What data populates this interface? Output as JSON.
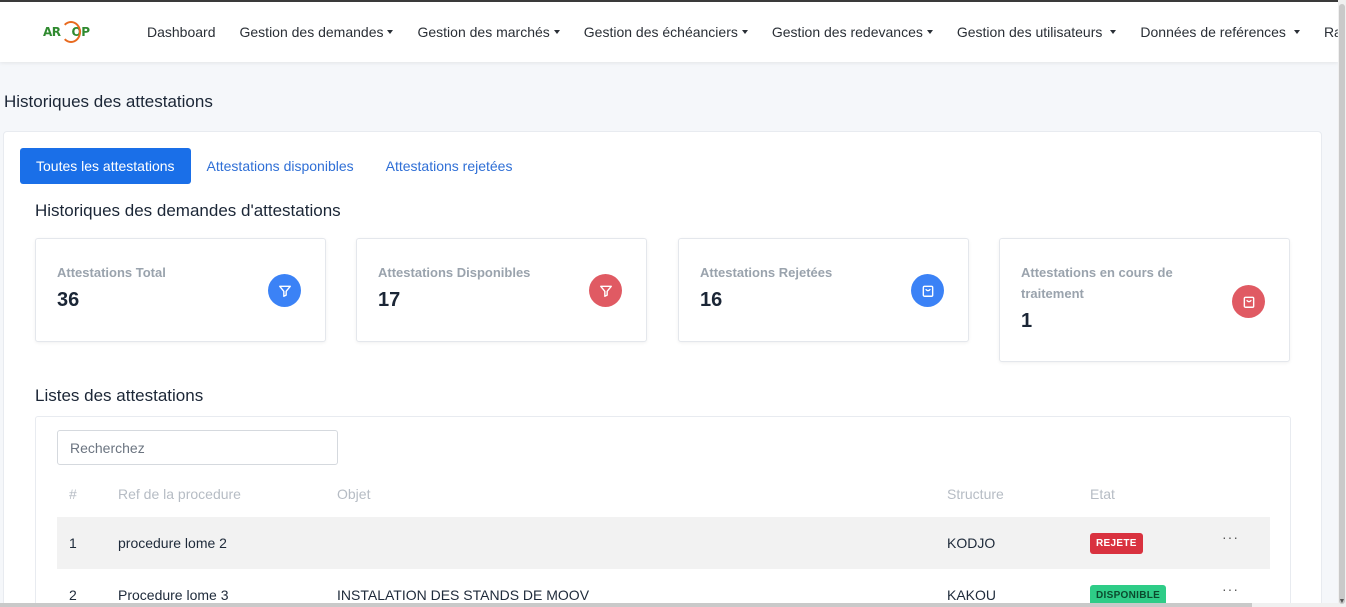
{
  "header": {
    "logo_text": "ARCOP",
    "nav": [
      {
        "label": "Dashboard",
        "dropdown": false
      },
      {
        "label": "Gestion des demandes",
        "dropdown": true
      },
      {
        "label": "Gestion des marchés",
        "dropdown": true
      },
      {
        "label": "Gestion des échéanciers",
        "dropdown": true
      },
      {
        "label": "Gestion des redevances",
        "dropdown": true
      },
      {
        "label": "Gestion des utilisateurs",
        "dropdown": true
      },
      {
        "label": "Données de reférences",
        "dropdown": true
      },
      {
        "label": "Rapports",
        "dropdown": false
      }
    ]
  },
  "page": {
    "title": "Historiques des attestations"
  },
  "tabs": [
    {
      "label": "Toutes les attestations",
      "active": true
    },
    {
      "label": "Attestations disponibles",
      "active": false
    },
    {
      "label": "Attestations rejetées",
      "active": false
    }
  ],
  "section_title": "Historiques des demandes d'attestations",
  "cards": [
    {
      "label": "Attestations Total",
      "value": "36",
      "icon": "filter-icon",
      "color": "#3b82f6"
    },
    {
      "label": "Attestations Disponibles",
      "value": "17",
      "icon": "filter-icon",
      "color": "#e05a63"
    },
    {
      "label": "Attestations Rejetées",
      "value": "16",
      "icon": "bag-icon",
      "color": "#3b82f6"
    },
    {
      "label": "Attestations en cours de traitement",
      "value": "1",
      "icon": "bag-icon",
      "color": "#e05a63"
    }
  ],
  "list": {
    "title": "Listes des attestations",
    "search_placeholder": "Recherchez",
    "columns": [
      "#",
      "Ref de la procedure",
      "Objet",
      "Structure",
      "Etat"
    ],
    "rows": [
      {
        "num": "1",
        "ref": "procedure lome 2",
        "objet": "",
        "structure": "KODJO",
        "etat": "REJETE",
        "etat_color": "#d9323f"
      },
      {
        "num": "2",
        "ref": "Procedure lome 3",
        "objet": "INSTALATION DES STANDS DE MOOV",
        "structure": "KAKOU",
        "etat": "DISPONIBLE",
        "etat_color": "#2ecc87"
      }
    ],
    "row_menu": "···"
  }
}
